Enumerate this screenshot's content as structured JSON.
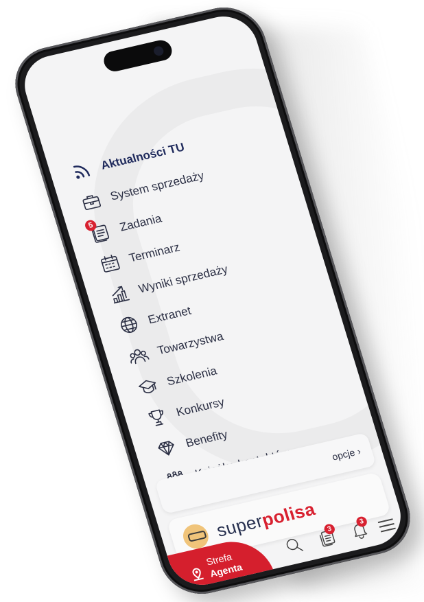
{
  "menu": [
    {
      "label": "Aktualności TU",
      "icon": "rss-icon",
      "bold": true
    },
    {
      "label": "System sprzedaży",
      "icon": "briefcase-icon"
    },
    {
      "label": "Zadania",
      "icon": "tasks-icon",
      "badge": "5"
    },
    {
      "label": "Terminarz",
      "icon": "calendar-icon"
    },
    {
      "label": "Wyniki sprzedaży",
      "icon": "chart-up-icon"
    },
    {
      "label": "Extranet",
      "icon": "globe-icon"
    },
    {
      "label": "Towarzystwa",
      "icon": "group-icon"
    },
    {
      "label": "Szkolenia",
      "icon": "graduation-cap-icon"
    },
    {
      "label": "Konkursy",
      "icon": "trophy-icon"
    },
    {
      "label": "Benefity",
      "icon": "diamond-icon"
    },
    {
      "label": "Książka kontaktów",
      "icon": "contacts-icon"
    }
  ],
  "options": {
    "label": "opcje",
    "chevron": "›"
  },
  "brand": {
    "part1": "super",
    "part2": "polisa"
  },
  "bottom": {
    "strefa_line1": "Strefa",
    "strefa_line2": "Agenta",
    "documents_badge": "3",
    "bell_badge": "3"
  },
  "colors": {
    "accent": "#d51f2d",
    "navy": "#27304f"
  }
}
